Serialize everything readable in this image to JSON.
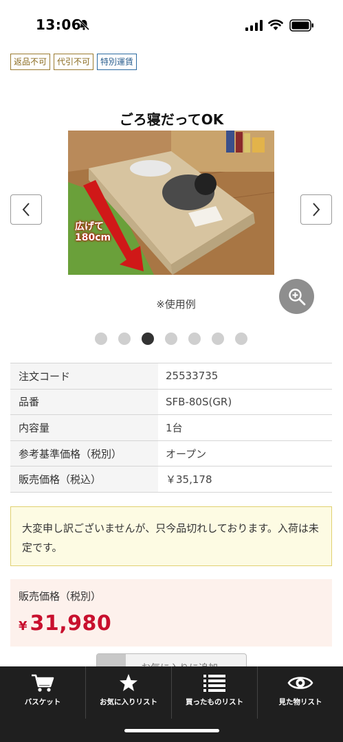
{
  "status_bar": {
    "time": "13:06"
  },
  "badges": [
    "返品不可",
    "代引不可",
    "特別運賃"
  ],
  "gallery": {
    "image_caption": "ごろ寝だってOK",
    "image_overlay_text_1": "広げて",
    "image_overlay_text_2": "180cm",
    "usage_note": "※使用例",
    "slide_count": 7,
    "active_slide": 3
  },
  "specs": [
    {
      "label": "注文コード",
      "value": "25533735"
    },
    {
      "label": "品番",
      "value": "SFB-80S(GR)"
    },
    {
      "label": "内容量",
      "value": "1台"
    },
    {
      "label": "参考基準価格（税別）",
      "value": "オープン"
    },
    {
      "label": "販売価格（税込）",
      "value": "￥35,178"
    }
  ],
  "notice": "大変申し訳ございませんが、只今品切れしております。入荷は未定です。",
  "price": {
    "label": "販売価格（税別）",
    "currency": "¥",
    "amount": "31,980"
  },
  "favorite_button_label": "お気に入りに追加",
  "bottom_nav": [
    {
      "label": "バスケット",
      "icon": "cart-icon"
    },
    {
      "label": "お気に入りリスト",
      "icon": "star-icon"
    },
    {
      "label": "買ったものリスト",
      "icon": "list-icon"
    },
    {
      "label": "見た物リスト",
      "icon": "eye-icon"
    }
  ],
  "colors": {
    "price_red": "#c8102e",
    "nav_bg": "#1f1f1f",
    "notice_bg": "#fdfbe3",
    "price_bg": "#fdf1ec"
  }
}
